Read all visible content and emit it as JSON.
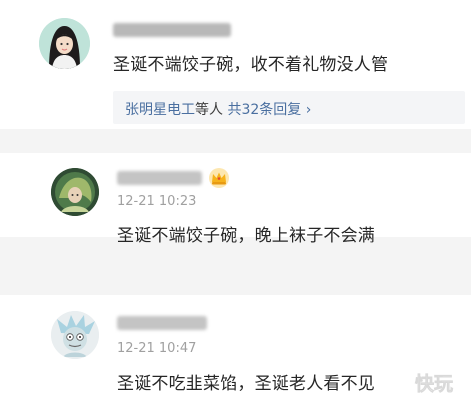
{
  "comments": [
    {
      "text": "圣诞不端饺子碗，收不着礼物没人管",
      "replies": {
        "users": "张明星电工",
        "connector": "等人",
        "count_label": "共32条回复",
        "arrow": "›"
      }
    },
    {
      "timestamp": "12-21 10:23",
      "text": "圣诞不端饺子碗，晚上袜子不会满",
      "badge_icon": "crown-icon"
    },
    {
      "timestamp": "12-21 10:47",
      "text": "圣诞不吃韭菜馅，圣诞老人看不见"
    }
  ],
  "watermark": {
    "text": "快玩"
  },
  "colors": {
    "link": "#4a6fa0",
    "text": "#262626",
    "muted": "#a0a0a0",
    "separator": "#f4f4f4",
    "crown": "#f6b21b"
  }
}
